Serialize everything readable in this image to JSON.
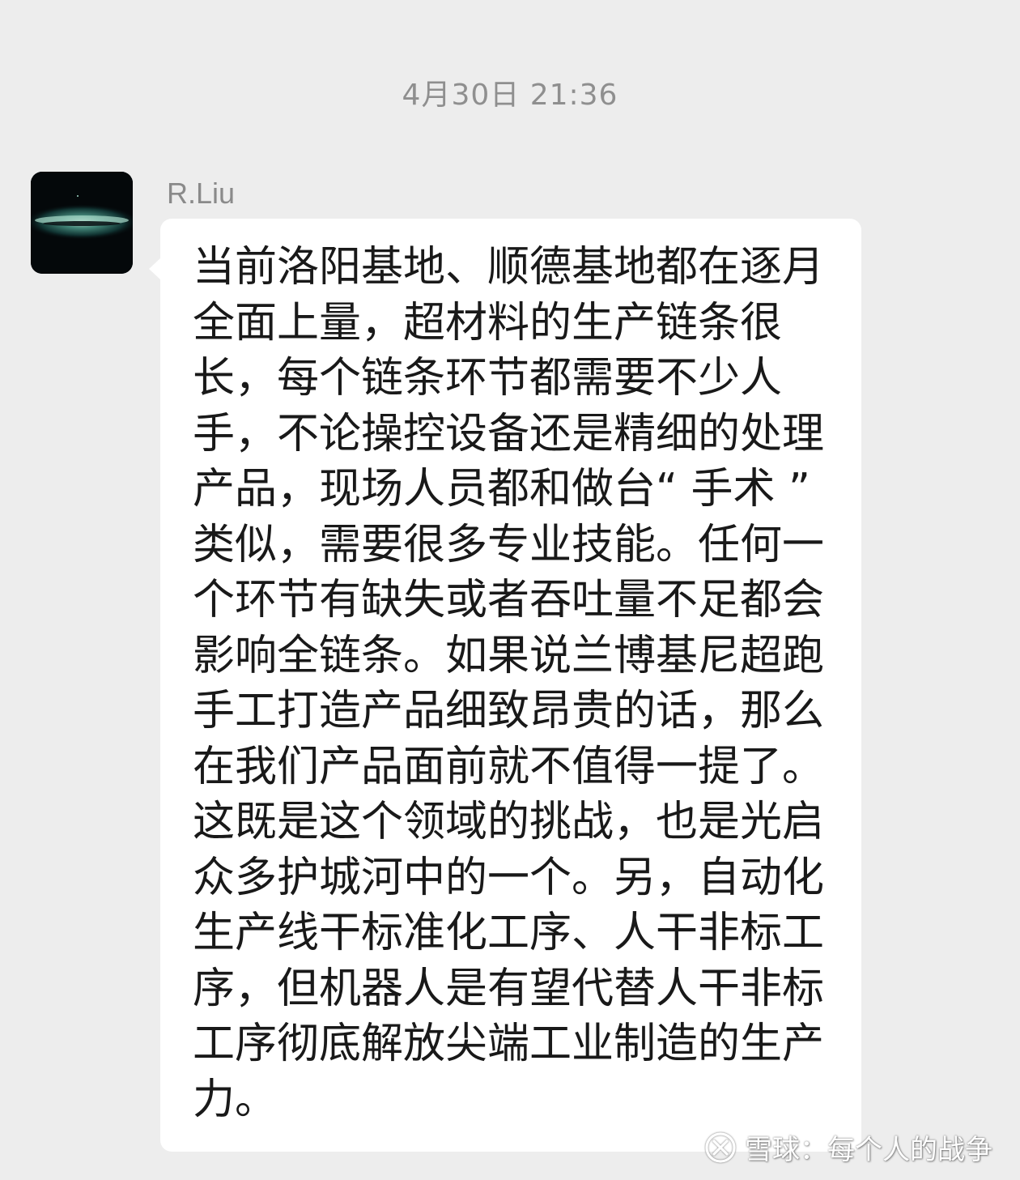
{
  "chat": {
    "timestamp": "4月30日 21:36",
    "message": {
      "sender": "R.Liu",
      "avatar_icon": "galaxy-avatar-icon",
      "lines": [
        "当前洛阳基地、顺德基地都在逐月",
        "全面上量，超材料的生产链条很",
        "长，每个链条环节都需要不少人",
        "手，不论操控设备还是精细的处理",
        "产品，现场人员都和做台“ 手术 ”",
        "类似，需要很多专业技能。任何一",
        "个环节有缺失或者吞吐量不足都会",
        "影响全链条。如果说兰博基尼超跑",
        "手工打造产品细致昂贵的话，那么",
        "在我们产品面前就不值得一提了。",
        "这既是这个领域的挑战，也是光启",
        "众多护城河中的一个。另，自动化",
        "生产线干标准化工序、人干非标工",
        "序，但机器人是有望代替人干非标",
        "工序彻底解放尖端工业制造的生产",
        "力。"
      ]
    }
  },
  "watermark": {
    "text": "雪球：每个人的战争",
    "icon": "xueqiu-logo-icon"
  },
  "colors": {
    "background": "#ededed",
    "bubble": "#ffffff",
    "text": "#191919",
    "meta_text": "#8f8f8f"
  }
}
